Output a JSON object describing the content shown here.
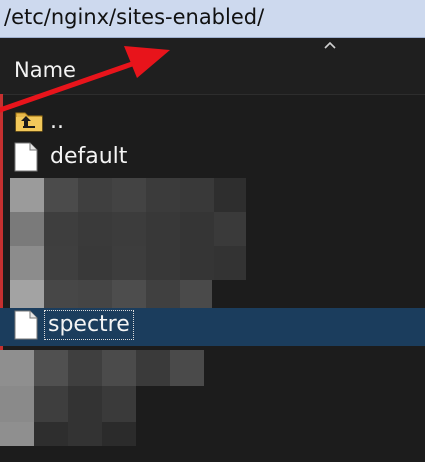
{
  "path_bar": {
    "path": "/etc/nginx/sites-enabled/"
  },
  "file_list": {
    "column_header": "Name",
    "sort_indicator_icon": "sort-ascending-icon",
    "rows": [
      {
        "label": "..",
        "icon": "folder-up-icon"
      },
      {
        "label": "default",
        "icon": "file-icon"
      },
      {
        "label": "spectre",
        "icon": "file-icon",
        "selected": true
      }
    ]
  },
  "annotation": {
    "arrow_color": "#e8141b"
  },
  "colors": {
    "path_bar_bg": "#cdd9ee",
    "panel_bg": "#1c1c1c",
    "selection_bg": "#1b3d5d",
    "text": "#f4f4f4"
  }
}
